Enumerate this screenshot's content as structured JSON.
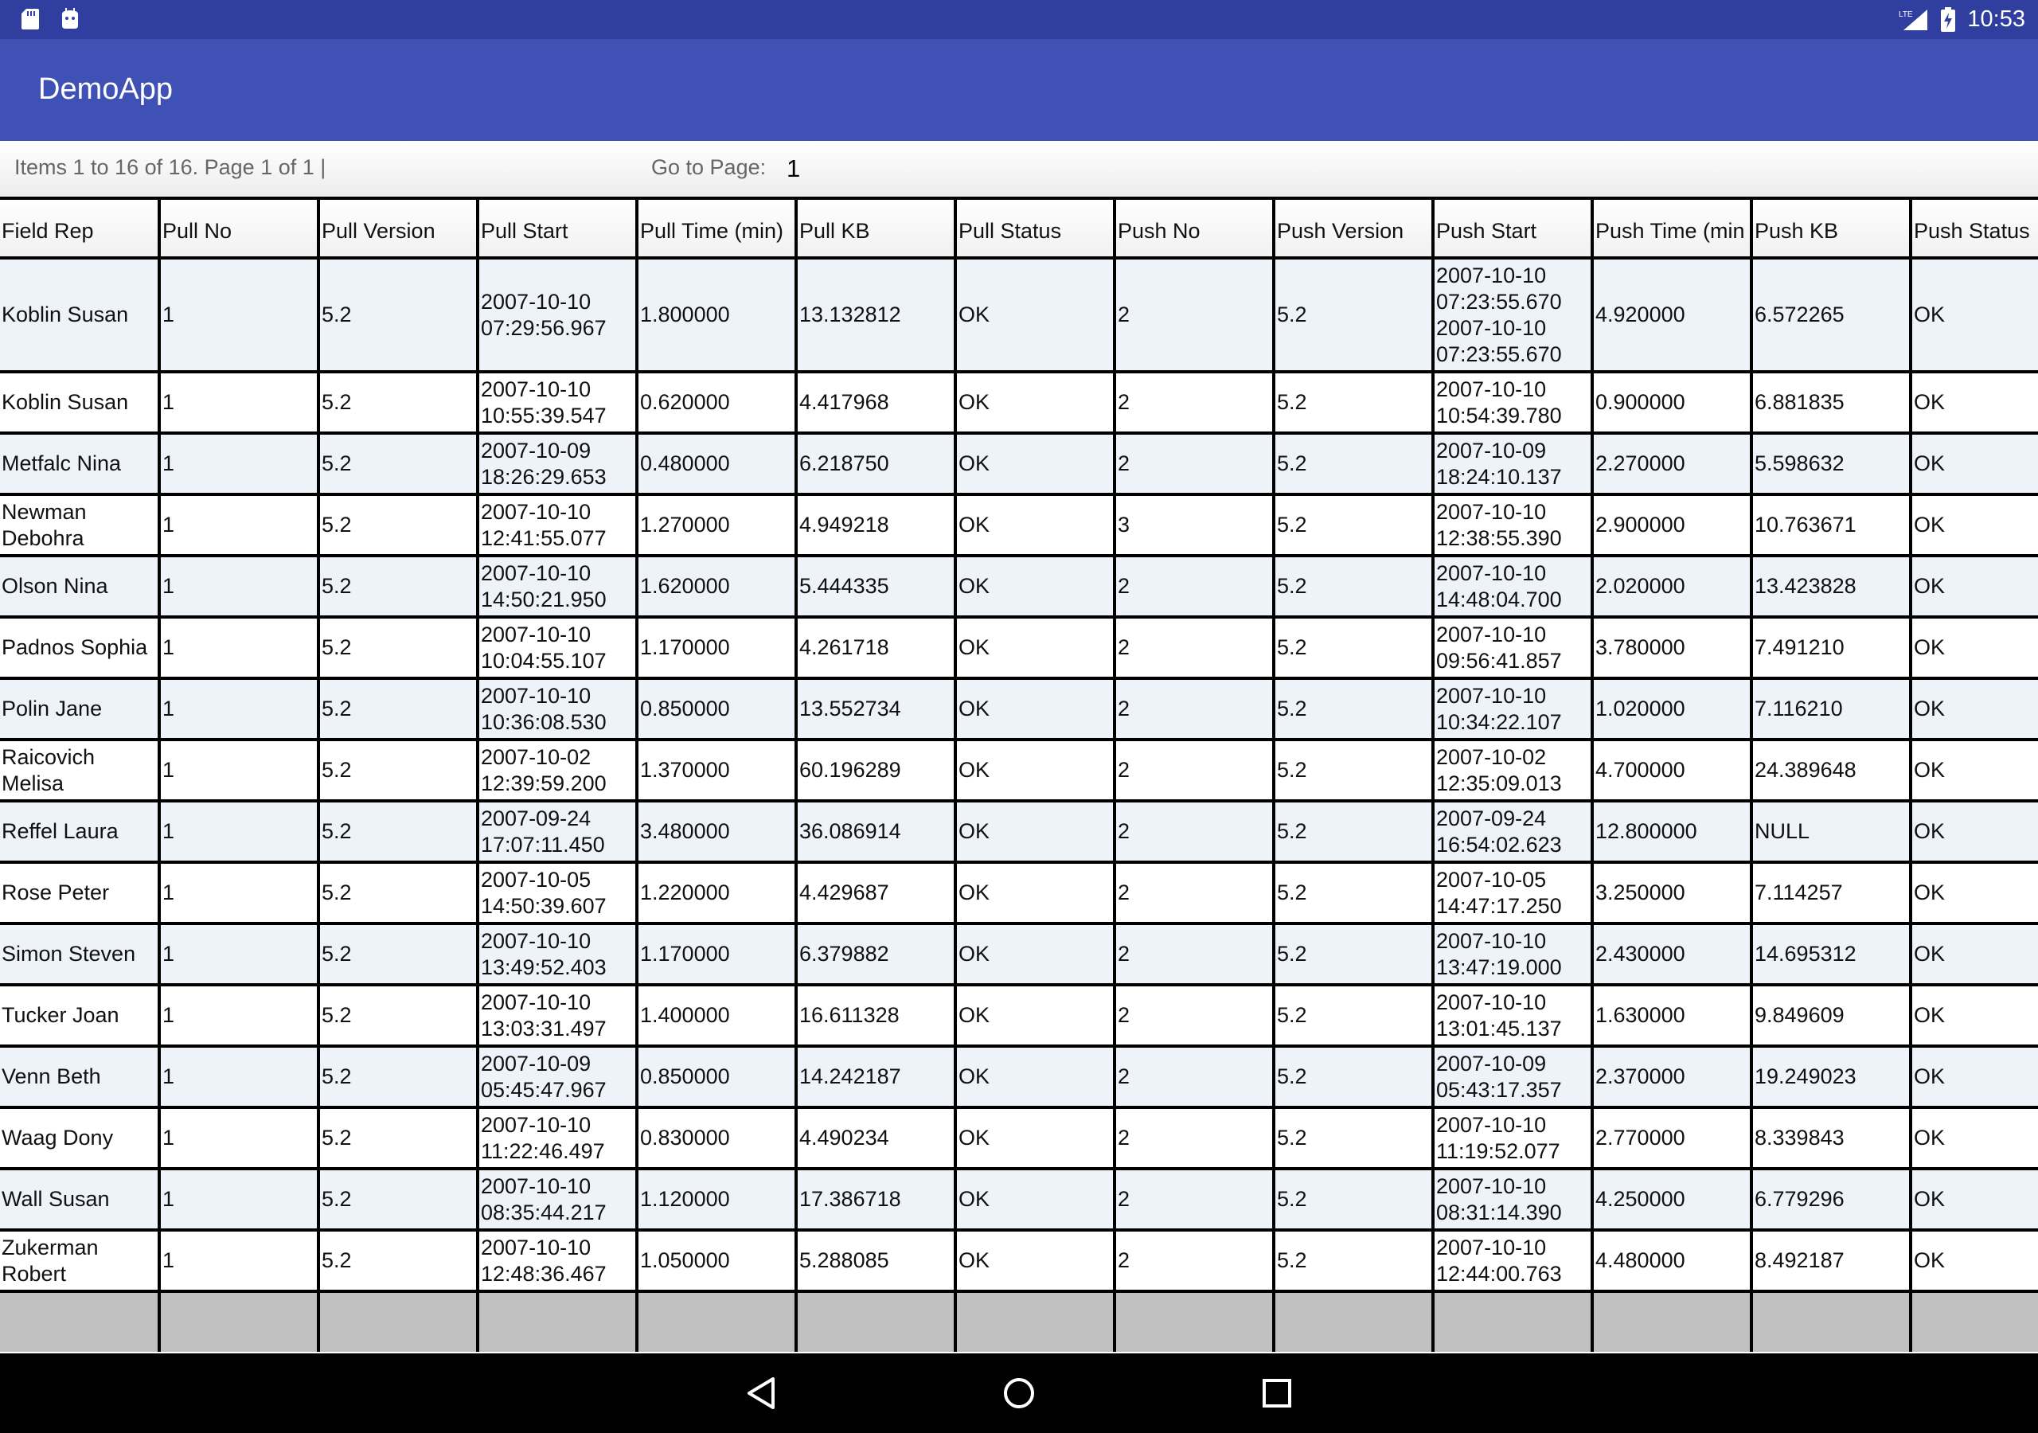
{
  "status_bar": {
    "left_icons": [
      "sd-card-icon",
      "android-icon"
    ],
    "right_icons": [
      "lte-signal-icon",
      "battery-charging-icon"
    ],
    "network_label": "LTE",
    "time": "10:53"
  },
  "app_bar": {
    "title": "DemoApp",
    "color": "#3f51b5",
    "status_color": "#303f9f"
  },
  "pager": {
    "info": "Items 1 to 16 of 16. Page 1 of 1 |",
    "goto_label": "Go to Page:",
    "goto_value": "1"
  },
  "table": {
    "columns": [
      "Field Rep",
      "Pull No",
      "Pull Version",
      "Pull Start",
      "Pull Time (min)",
      "Pull KB",
      "Pull Status",
      "Push No",
      "Push Version",
      "Push Start",
      "Push Time (min",
      "Push KB",
      "Push Status"
    ],
    "rows": [
      [
        "Koblin Susan",
        "1",
        "5.2",
        "2007-10-10 07:29:56.967",
        "1.800000",
        "13.132812",
        "OK",
        "2",
        "5.2",
        "2007-10-10 07:23:55.670 2007-10-10 07:23:55.670",
        "4.920000",
        "6.572265",
        "OK"
      ],
      [
        "Koblin Susan",
        "1",
        "5.2",
        "2007-10-10 10:55:39.547",
        "0.620000",
        "4.417968",
        "OK",
        "2",
        "5.2",
        "2007-10-10 10:54:39.780",
        "0.900000",
        "6.881835",
        "OK"
      ],
      [
        "Metfalc Nina",
        "1",
        "5.2",
        "2007-10-09 18:26:29.653",
        "0.480000",
        "6.218750",
        "OK",
        "2",
        "5.2",
        "2007-10-09 18:24:10.137",
        "2.270000",
        "5.598632",
        "OK"
      ],
      [
        "Newman Debohra",
        "1",
        "5.2",
        "2007-10-10 12:41:55.077",
        "1.270000",
        "4.949218",
        "OK",
        "3",
        "5.2",
        "2007-10-10 12:38:55.390",
        "2.900000",
        "10.763671",
        "OK"
      ],
      [
        "Olson Nina",
        "1",
        "5.2",
        "2007-10-10 14:50:21.950",
        "1.620000",
        "5.444335",
        "OK",
        "2",
        "5.2",
        "2007-10-10 14:48:04.700",
        "2.020000",
        "13.423828",
        "OK"
      ],
      [
        "Padnos Sophia",
        "1",
        "5.2",
        "2007-10-10 10:04:55.107",
        "1.170000",
        "4.261718",
        "OK",
        "2",
        "5.2",
        "2007-10-10 09:56:41.857",
        "3.780000",
        "7.491210",
        "OK"
      ],
      [
        "Polin Jane",
        "1",
        "5.2",
        "2007-10-10 10:36:08.530",
        "0.850000",
        "13.552734",
        "OK",
        "2",
        "5.2",
        "2007-10-10 10:34:22.107",
        "1.020000",
        "7.116210",
        "OK"
      ],
      [
        "Raicovich Melisa",
        "1",
        "5.2",
        "2007-10-02 12:39:59.200",
        "1.370000",
        "60.196289",
        "OK",
        "2",
        "5.2",
        "2007-10-02 12:35:09.013",
        "4.700000",
        "24.389648",
        "OK"
      ],
      [
        "Reffel Laura",
        "1",
        "5.2",
        "2007-09-24 17:07:11.450",
        "3.480000",
        "36.086914",
        "OK",
        "2",
        "5.2",
        "2007-09-24 16:54:02.623",
        "12.800000",
        "NULL",
        "OK"
      ],
      [
        "Rose Peter",
        "1",
        "5.2",
        "2007-10-05 14:50:39.607",
        "1.220000",
        "4.429687",
        "OK",
        "2",
        "5.2",
        "2007-10-05 14:47:17.250",
        "3.250000",
        "7.114257",
        "OK"
      ],
      [
        "Simon Steven",
        "1",
        "5.2",
        "2007-10-10 13:49:52.403",
        "1.170000",
        "6.379882",
        "OK",
        "2",
        "5.2",
        "2007-10-10 13:47:19.000",
        "2.430000",
        "14.695312",
        "OK"
      ],
      [
        "Tucker Joan",
        "1",
        "5.2",
        "2007-10-10 13:03:31.497",
        "1.400000",
        "16.611328",
        "OK",
        "2",
        "5.2",
        "2007-10-10 13:01:45.137",
        "1.630000",
        "9.849609",
        "OK"
      ],
      [
        "Venn Beth",
        "1",
        "5.2",
        "2007-10-09 05:45:47.967",
        "0.850000",
        "14.242187",
        "OK",
        "2",
        "5.2",
        "2007-10-09 05:43:17.357",
        "2.370000",
        "19.249023",
        "OK"
      ],
      [
        "Waag Dony",
        "1",
        "5.2",
        "2007-10-10 11:22:46.497",
        "0.830000",
        "4.490234",
        "OK",
        "2",
        "5.2",
        "2007-10-10 11:19:52.077",
        "2.770000",
        "8.339843",
        "OK"
      ],
      [
        "Wall Susan",
        "1",
        "5.2",
        "2007-10-10 08:35:44.217",
        "1.120000",
        "17.386718",
        "OK",
        "2",
        "5.2",
        "2007-10-10 08:31:14.390",
        "4.250000",
        "6.779296",
        "OK"
      ],
      [
        "Zukerman Robert",
        "1",
        "5.2",
        "2007-10-10 12:48:36.467",
        "1.050000",
        "5.288085",
        "OK",
        "2",
        "5.2",
        "2007-10-10 12:44:00.763",
        "4.480000",
        "8.492187",
        "OK"
      ]
    ]
  },
  "nav_bar": {
    "buttons": [
      "back-icon",
      "home-icon",
      "recents-icon"
    ]
  }
}
